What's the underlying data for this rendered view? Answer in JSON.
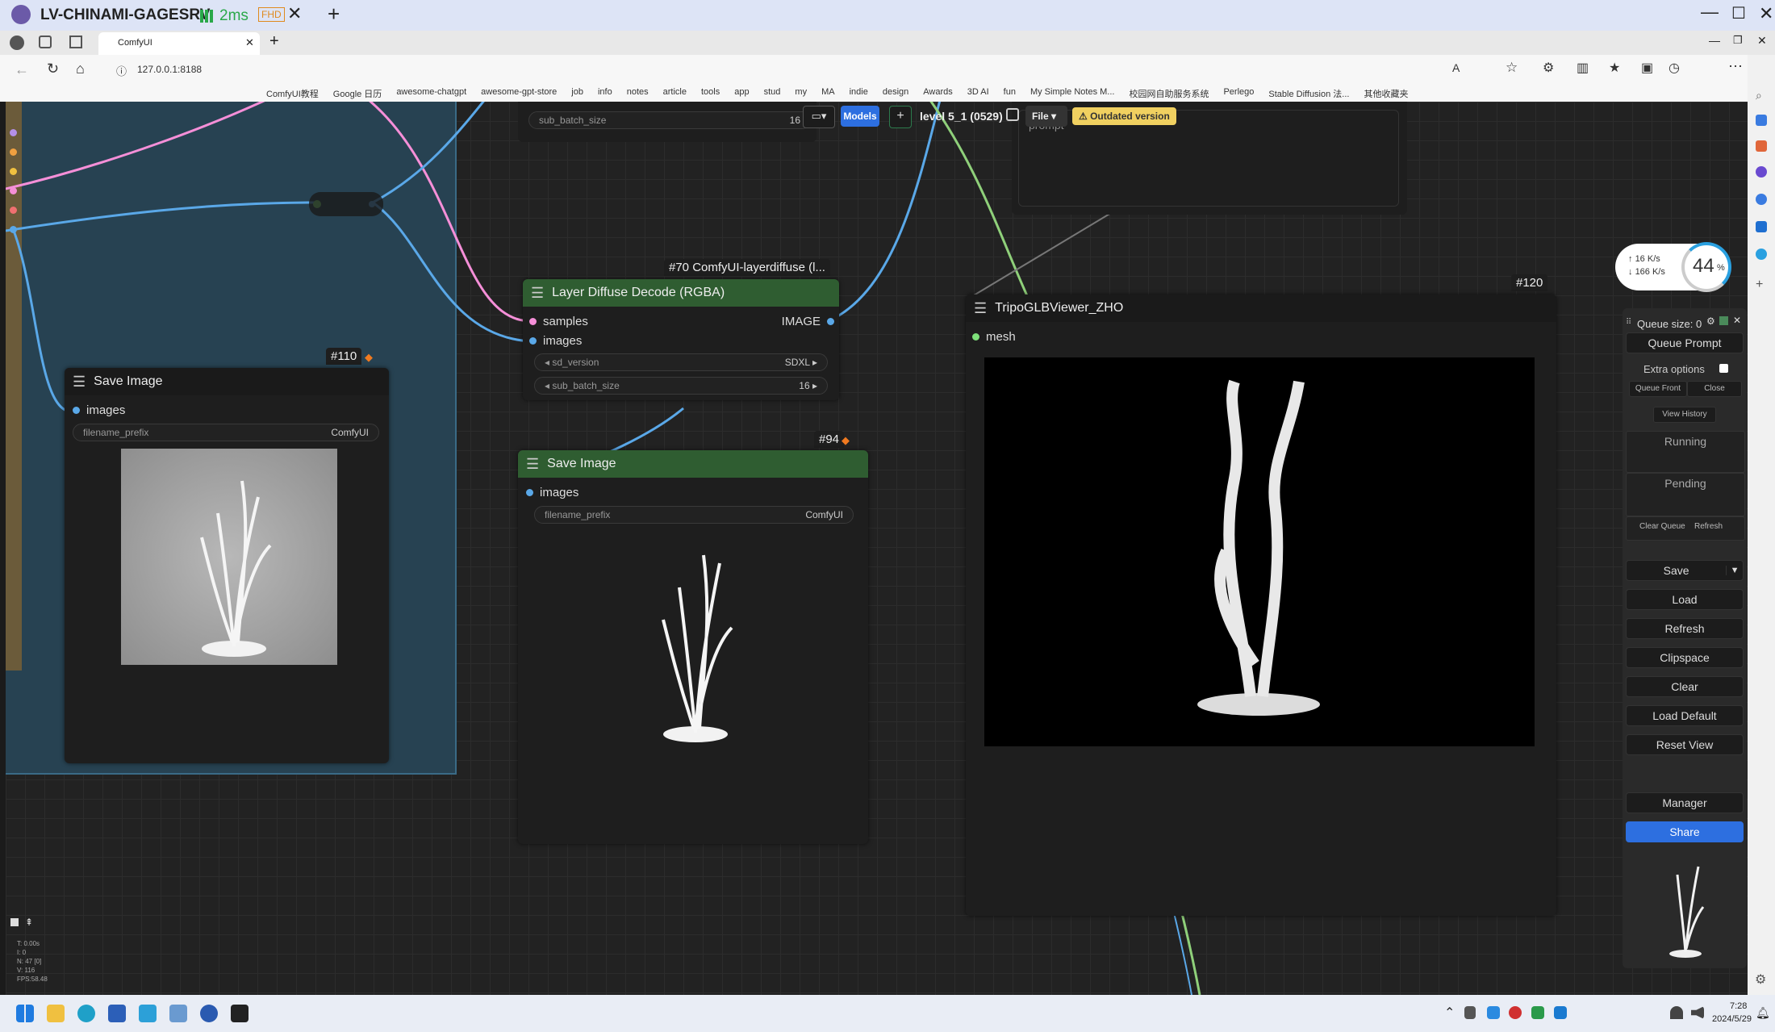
{
  "remote": {
    "title": "LV-CHINAMI-GAGESRV",
    "latency": "2ms",
    "quality": "FHD"
  },
  "browser": {
    "tab_title": "ComfyUI",
    "url": "127.0.0.1:8188",
    "bookmarks": [
      "ComfyUI教程",
      "Google 日历",
      "awesome-chatgpt",
      "awesome-gpt-store",
      "job",
      "info",
      "notes",
      "article",
      "tools",
      "app",
      "stud",
      "my",
      "MA",
      "indie",
      "design",
      "Awards",
      "3D AI",
      "fun",
      "My Simple Notes M...",
      "校园网自助服务系统",
      "Perlego",
      "Stable Diffusion 法...",
      "其他收藏夹"
    ]
  },
  "toolbar": {
    "models_label": "Models",
    "add_label": "+",
    "workflow_name": "level 5_1 (0529)",
    "file_label": "File",
    "outdated_label": "Outdated version"
  },
  "top_widget": {
    "label": "sub_batch_size",
    "value": "16"
  },
  "top_prompt": {
    "placeholder": "prompt"
  },
  "speed": {
    "up": "16 K/s",
    "down": "166 K/s",
    "percent": "44",
    "percent_sign": "%"
  },
  "nodes": {
    "save110": {
      "id": "#110",
      "title": "Save Image",
      "input": "images",
      "widget_label": "filename_prefix",
      "widget_value": "ComfyUI"
    },
    "layer70": {
      "id": "#70 ComfyUI-layerdiffuse (l...",
      "title": "Layer Diffuse Decode (RGBA)",
      "in1": "samples",
      "in2": "images",
      "out": "IMAGE",
      "w1_label": "sd_version",
      "w1_value": "SDXL",
      "w2_label": "sub_batch_size",
      "w2_value": "16"
    },
    "save94": {
      "id": "#94",
      "title": "Save Image",
      "input": "images",
      "widget_label": "filename_prefix",
      "widget_value": "ComfyUI"
    },
    "tripo120": {
      "id": "#120",
      "title": "TripoGLBViewer_ZHO",
      "input": "mesh"
    }
  },
  "menu": {
    "queue_size": "Queue size: 0",
    "queue_prompt": "Queue Prompt",
    "extra_options": "Extra options",
    "queue_front": "Queue Front",
    "close": "Close",
    "view_history": "View History",
    "running": "Running",
    "pending": "Pending",
    "clear_queue": "Clear Queue",
    "refresh_small": "Refresh",
    "save": "Save",
    "load": "Load",
    "refresh": "Refresh",
    "clipspace": "Clipspace",
    "clear": "Clear",
    "load_default": "Load Default",
    "reset_view": "Reset View",
    "manager": "Manager",
    "share": "Share"
  },
  "stats": {
    "t": "T: 0.00s",
    "i": "I: 0",
    "n": "N: 47 [0]",
    "v": "V: 116",
    "fps": "FPS:58.48"
  },
  "clock": {
    "time": "7:28",
    "date": "2024/5/29"
  },
  "colors": {
    "green_header": "#2f5d31",
    "accent_blue": "#2d6fe0",
    "wire_blue": "#5aa8e8",
    "wire_pink": "#f58fd8",
    "wire_green": "#8fd07a"
  }
}
